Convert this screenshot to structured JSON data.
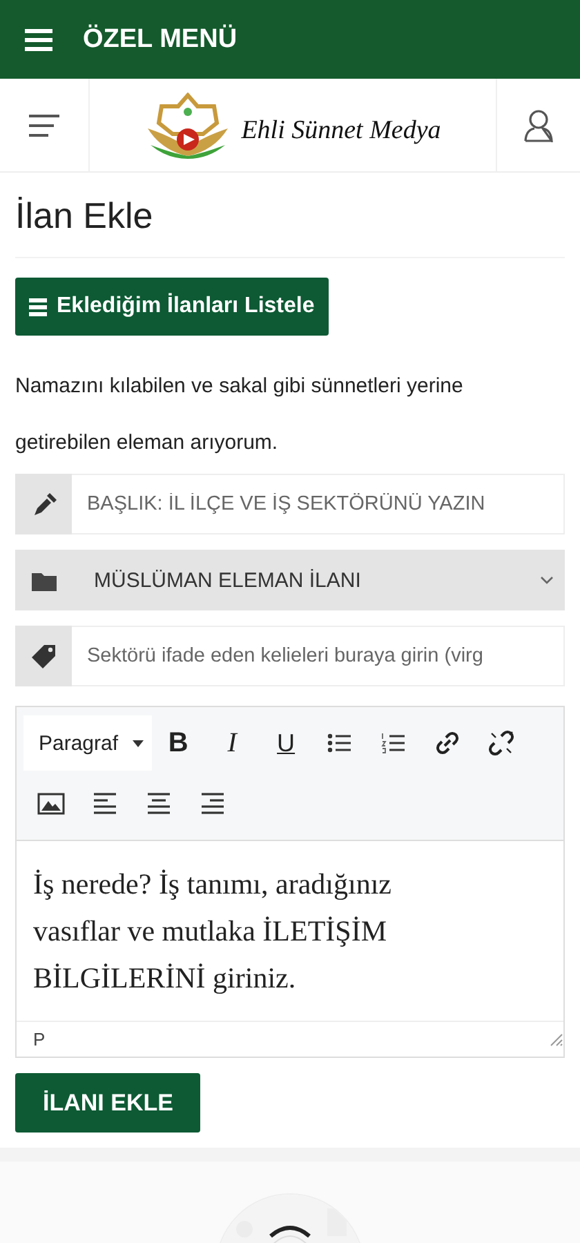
{
  "top_bar": {
    "menu_title": "ÖZEL MENÜ"
  },
  "site_nav": {
    "logo_text": "Ehli Sünnet Medya"
  },
  "page_title": "İlan Ekle",
  "list_button": {
    "label": "Eklediğim İlanları Listele"
  },
  "intro": "Namazını kılabilen ve sakal gibi sünnetleri yerine getirebilen eleman arıyorum.",
  "fields": [
    {
      "kind": "input",
      "placeholder": "BAŞLIK: İL İLÇE VE İŞ SEKTÖRÜNÜ YAZIN"
    },
    {
      "kind": "select",
      "value": "MÜSLÜMAN ELEMAN İLANI"
    },
    {
      "kind": "input",
      "placeholder": "Sektörü ifade eden kelieleri buraya girin (virg"
    }
  ],
  "editor": {
    "format": "Paragraf",
    "style_buttons": [
      "B",
      "I",
      "U"
    ],
    "content": "İş nerede? İş tanımı, aradığınız vasıflar ve mutlaka İLETİŞİM BİLGİLERİNİ giriniz.",
    "status_path": "P"
  },
  "submit_button": {
    "label": "İLANI EKLE"
  }
}
